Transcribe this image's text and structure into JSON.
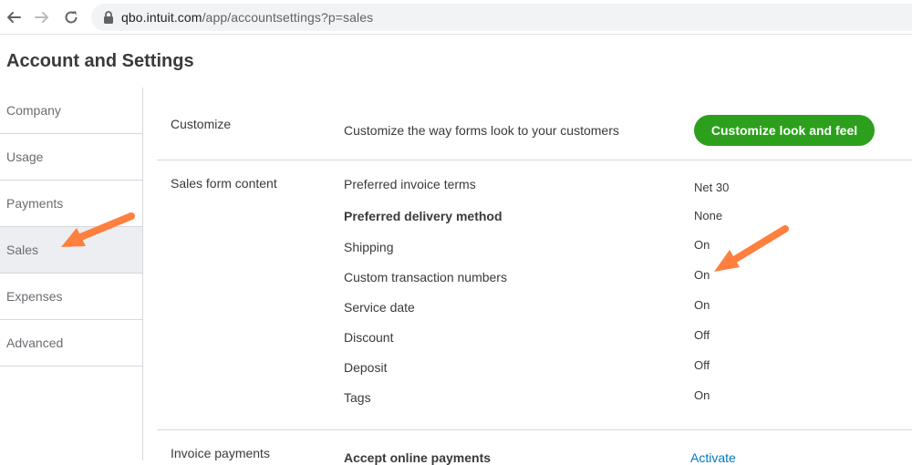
{
  "browser": {
    "url_host": "qbo.intuit.com",
    "url_path": "/app/accountsettings?p=sales",
    "back_icon": "arrow-left-icon",
    "forward_icon": "arrow-right-icon",
    "reload_icon": "reload-icon",
    "lock_icon": "lock-icon"
  },
  "page": {
    "title": "Account and Settings"
  },
  "sidebar": {
    "items": [
      {
        "label": "Company",
        "active": false
      },
      {
        "label": "Usage",
        "active": false
      },
      {
        "label": "Payments",
        "active": false
      },
      {
        "label": "Sales",
        "active": true
      },
      {
        "label": "Expenses",
        "active": false
      },
      {
        "label": "Advanced",
        "active": false
      }
    ]
  },
  "sections": {
    "customize": {
      "label": "Customize",
      "description": "Customize the way forms look to your customers",
      "button_label": "Customize look and feel"
    },
    "sales_form_content": {
      "label": "Sales form content",
      "rows": [
        {
          "label": "Preferred invoice terms",
          "value": "Net 30"
        },
        {
          "label": "Preferred delivery method",
          "value": "None"
        },
        {
          "label": "Shipping",
          "value": "On"
        },
        {
          "label": "Custom transaction numbers",
          "value": "On"
        },
        {
          "label": "Service date",
          "value": "On"
        },
        {
          "label": "Discount",
          "value": "Off"
        },
        {
          "label": "Deposit",
          "value": "Off"
        },
        {
          "label": "Tags",
          "value": "On"
        }
      ]
    },
    "invoice_payments": {
      "label": "Invoice payments",
      "row_label": "Accept online payments",
      "link_label": "Activate"
    }
  },
  "colors": {
    "primary_button": "#2ca01c",
    "link": "#0077c5",
    "annotation_arrow": "#ff7f3f",
    "active_sidebar_bg": "#eceef1"
  }
}
